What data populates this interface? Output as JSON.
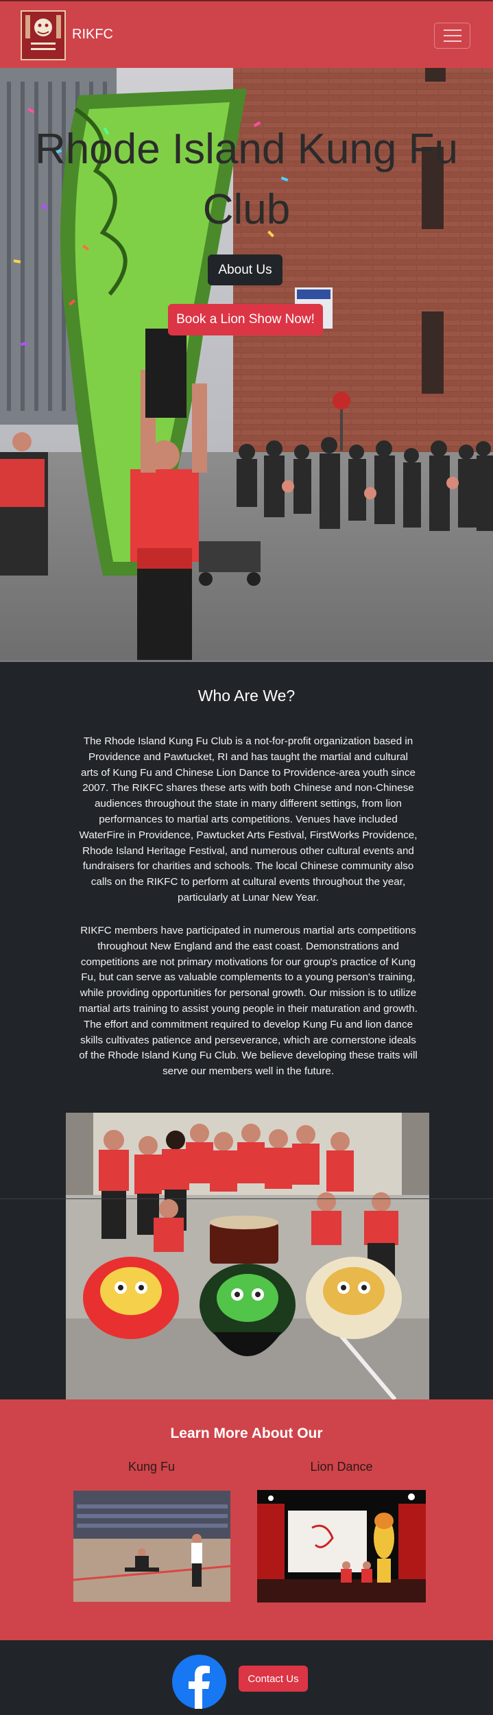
{
  "navbar": {
    "brand_text": "RIKFC",
    "logo_text": "Rhode Island Kung Fu Club",
    "toggler_icon": "hamburger-menu-icon"
  },
  "hero": {
    "title": "Rhode Island Kung Fu Club",
    "about_button": "About Us",
    "book_button": "Book a Lion Show Now!"
  },
  "who": {
    "title": "Who Are We?",
    "paragraph1": "The Rhode Island Kung Fu Club is a not-for-profit organization based in Providence and Pawtucket, RI and has taught the martial and cultural arts of Kung Fu and Chinese Lion Dance to Providence-area youth since 2007. The RIKFC shares these arts with both Chinese and non-Chinese audiences throughout the state in many different settings, from lion performances to martial arts competitions. Venues have included WaterFire in Providence, Pawtucket Arts Festival, FirstWorks Providence, Rhode Island Heritage Festival, and numerous other cultural events and fundraisers for charities and schools. The local Chinese community also calls on the RIKFC to perform at cultural events throughout the year, particularly at Lunar New Year.",
    "paragraph2": "RIKFC members have participated in numerous martial arts competitions throughout New England and the east coast. Demonstrations and competitions are not primary motivations for our group's practice of Kung Fu, but can serve as valuable complements to a young person's training, while providing opportunities for personal growth. Our mission is to utilize martial arts training to assist young people in their maturation and growth. The effort and commitment required to develop Kung Fu and lion dance skills cultivates patience and perseverance, which are cornerstone ideals of the Rhode Island Kung Fu Club. We believe developing these traits will serve our members well in the future."
  },
  "learn": {
    "title": "Learn More About Our",
    "kung_fu": "Kung Fu",
    "lion_dance": "Lion Dance"
  },
  "footer": {
    "facebook_icon": "facebook-icon",
    "contact_button": "Contact Us"
  },
  "colors": {
    "brand_red": "#cf444a",
    "button_red": "#dc3545",
    "dark": "#212529"
  }
}
